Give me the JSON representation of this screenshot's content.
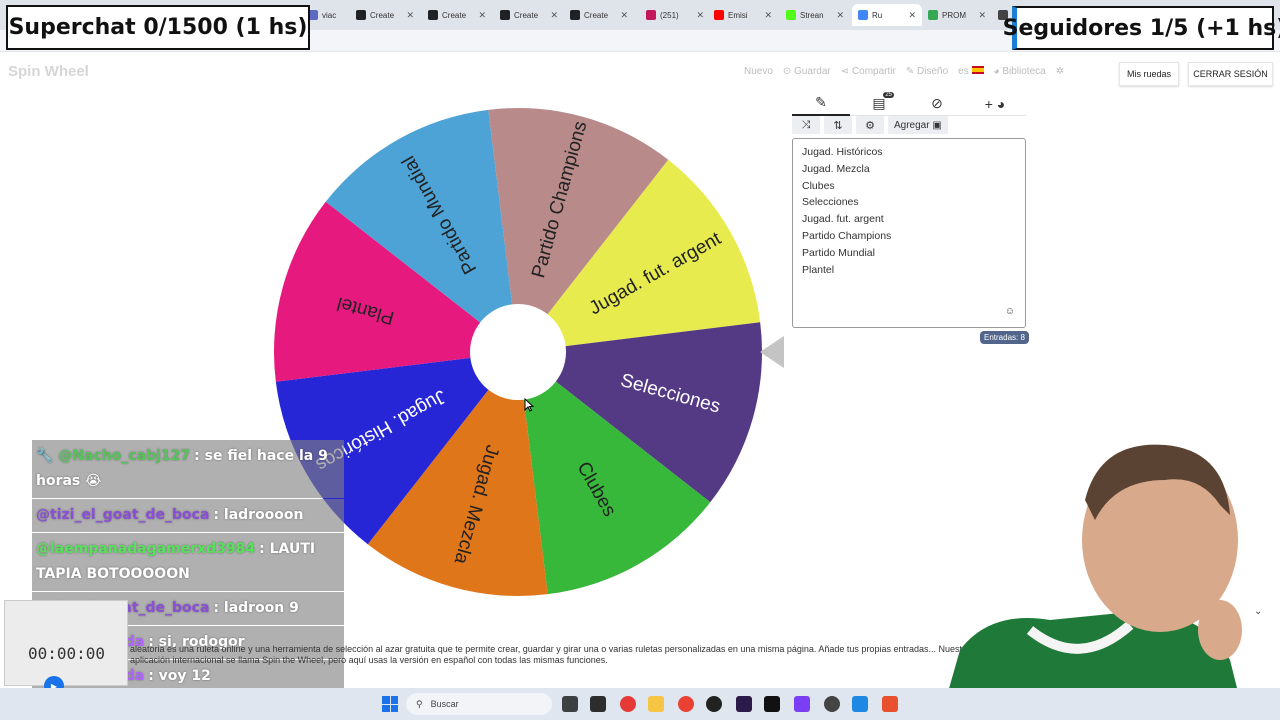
{
  "browser": {
    "tabs": [
      {
        "label": "viac",
        "color": "#5c6bc0"
      },
      {
        "label": "Create",
        "color": "#202124"
      },
      {
        "label": "Create",
        "color": "#202124"
      },
      {
        "label": "Create",
        "color": "#202124"
      },
      {
        "label": "Create",
        "color": "#202124"
      },
      {
        "label": "(251)",
        "color": "#c2185b"
      },
      {
        "label": "Emisi",
        "color": "#ff0000"
      },
      {
        "label": "Strean",
        "color": "#53fc18"
      },
      {
        "label": "Ru",
        "color": "#4285f4"
      },
      {
        "label": "PROM",
        "color": "#34a853"
      },
      {
        "label": "W",
        "color": "#444444"
      }
    ],
    "close_glyph": "✕"
  },
  "overlays": {
    "superchat": "Superchat 0/1500 (1 hs)",
    "seguidores": "Seguidores 1/5 (+1 hs)"
  },
  "header": {
    "brand": "Spin Wheel",
    "nav": {
      "nuevo": "Nuevo",
      "guardar": "Guardar",
      "compartir": "Compartir",
      "diseno": "Diseño",
      "lang": "es",
      "biblioteca": "Biblioteca"
    },
    "mis_ruedas": "Mis ruedas",
    "cerrar_sesion": "CERRAR SESIÓN"
  },
  "wheel": {
    "slices": [
      {
        "label": "Jugad. fut. argent",
        "color": "#e8eb4e",
        "text_color": "#222222"
      },
      {
        "label": "Selecciones",
        "color": "#543a85",
        "text_color": "#ffffff"
      },
      {
        "label": "Clubes",
        "color": "#38b83a",
        "text_color": "#222222"
      },
      {
        "label": "Jugad. Mezcla",
        "color": "#e0761a",
        "text_color": "#222222"
      },
      {
        "label": "Jugad. Históricos",
        "color": "#2626d6",
        "text_color": "#ffffff"
      },
      {
        "label": "Plantel",
        "color": "#e6197f",
        "text_color": "#222222"
      },
      {
        "label": "Partido Mundial",
        "color": "#4da3d6",
        "text_color": "#222222"
      },
      {
        "label": "Partido Champions",
        "color": "#b88a8a",
        "text_color": "#222222"
      }
    ]
  },
  "panel": {
    "tab_icons": [
      "pencil-icon",
      "clipboard-icon",
      "eye-off-icon",
      "plus-icon"
    ],
    "clipboard_badge": "25",
    "agregar": "Agregar",
    "entries": [
      "Jugad. Históricos",
      "Jugad. Mezcla",
      "Clubes",
      "Selecciones",
      "Jugad. fut. argent",
      "Partido Champions",
      "Partido Mundial",
      "Plantel"
    ],
    "entradas": "Entradas: 8"
  },
  "chat": [
    {
      "user": "@Nacho_cabj127",
      "text": ": se fiel hace la 9 horas 😭",
      "color": "#56c45a",
      "prefix": "🔧"
    },
    {
      "user": "@tizi_el_goat_de_boca",
      "text": ": ladroooon",
      "color": "#8a4fd6"
    },
    {
      "user": "@laempanadagamerxd3984",
      "text": ": LAUTI TAPIA BOTOOOOON",
      "color": "#56e25a"
    },
    {
      "user": "@tizi_el_goat_de_boca",
      "text": ": ladroon 9",
      "color": "#8a4fd6"
    },
    {
      "user": "Rodagorda",
      "text": ": si, rodogor",
      "color": "#b065ff",
      "prefix": "🔧"
    },
    {
      "user": "Rodagorda",
      "text": ": voy 12",
      "color": "#b065ff",
      "prefix": "🔧"
    }
  ],
  "page": {
    "description": "aleatoria es una ruleta online y una herramienta de selección al azar gratuita que te permite crear, guardar y girar una o varias ruletas personalizadas en una misma página. Añade tus propias entradas... Nuestra aplicación internacional se llama Spin the Wheel, pero aquí usas la versión en español con todas las mismas funciones."
  },
  "timer": {
    "value": "00:00:00"
  },
  "taskbar": {
    "search": "Buscar"
  }
}
